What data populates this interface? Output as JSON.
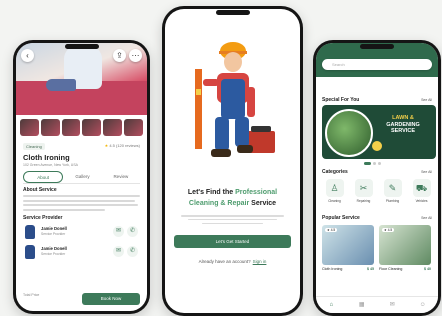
{
  "left_screen": {
    "top_buttons": {
      "back": "‹",
      "share": "⇪",
      "more": "⋯"
    },
    "category_chip": "Cleaning",
    "rating_text": "4.5 (120 reviews)",
    "service_title": "Cloth Ironing",
    "address": "102 Green Avenue, New York, USA",
    "tabs": [
      "About",
      "Gallery",
      "Review"
    ],
    "about_heading": "About Service",
    "provider_heading": "Service Provider",
    "providers": [
      {
        "name": "Jamie Donell",
        "role": "Service Provider"
      },
      {
        "name": "Jamie Donell",
        "role": "Service Provider"
      }
    ],
    "price_label": "Total Price",
    "book_button": "Book Now"
  },
  "center_screen": {
    "headline_pre": "Let's Find the ",
    "headline_accent": "Professional Cleaning & Repair",
    "headline_post": " Service",
    "start_button": "Let's Get Started",
    "signin_prompt": "Already have an account?",
    "signin_link": "Sign in"
  },
  "right_screen": {
    "search_placeholder": "Search",
    "special_heading": "Special For You",
    "special_see_all": "See All",
    "promo_line1": "LAWN &",
    "promo_line2": "GARDENING",
    "promo_line3": "SERVICE",
    "categories_heading": "Categories",
    "categories_see_all": "See All",
    "categories": [
      {
        "label": "Cleaning",
        "icon": "broom-icon",
        "glyph": "♙"
      },
      {
        "label": "Repairing",
        "icon": "tools-icon",
        "glyph": "✂"
      },
      {
        "label": "Plumbing",
        "icon": "wrench-icon",
        "glyph": "✎"
      },
      {
        "label": "Vehicles",
        "icon": "truck-icon",
        "glyph": "⛟"
      }
    ],
    "popular_heading": "Popular Service",
    "popular_see_all": "See All",
    "popular": [
      {
        "badge": "★ 4.5",
        "name": "Cloth Ironing",
        "price": "$ 45"
      },
      {
        "badge": "★ 4.5",
        "name": "Floor Cleaning",
        "price": "$ 40"
      }
    ],
    "nav": [
      {
        "icon": "home-icon",
        "glyph": "⌂"
      },
      {
        "icon": "calendar-icon",
        "glyph": "▦"
      },
      {
        "icon": "chat-icon",
        "glyph": "✉"
      },
      {
        "icon": "profile-icon",
        "glyph": "☺"
      }
    ]
  },
  "colors": {
    "primary_green": "#3d7a5a",
    "dark_green": "#2f6a4c",
    "accent_yellow": "#f4d04a"
  }
}
